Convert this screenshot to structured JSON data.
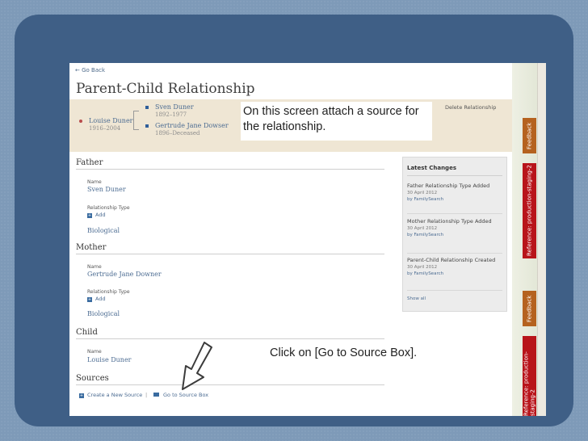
{
  "nav": {
    "go_back": "← Go Back"
  },
  "page": {
    "title": "Parent-Child Relationship",
    "delete_label": "Delete Relationship"
  },
  "tree": {
    "child_name": "Louise Duner",
    "child_years": "1916–2004",
    "father_name": "Sven Duner",
    "father_years": "1892–1977",
    "mother_name": "Gertrude Jane Dowser",
    "mother_years": "1896–Deceased"
  },
  "father": {
    "heading": "Father",
    "name_label": "Name",
    "name": "Sven Duner",
    "rel_type_label": "Relationship Type",
    "add_label": "Add",
    "type_value": "Biological"
  },
  "mother": {
    "heading": "Mother",
    "name_label": "Name",
    "name": "Gertrude Jane Downer",
    "rel_type_label": "Relationship Type",
    "add_label": "Add",
    "type_value": "Biological"
  },
  "child": {
    "heading": "Child",
    "name_label": "Name",
    "name": "Louise Duner"
  },
  "sources": {
    "heading": "Sources",
    "create_label": "Create a New Source",
    "separator": "|",
    "goto_label": "Go to Source Box"
  },
  "latest_changes": {
    "heading": "Latest Changes",
    "items": [
      {
        "title": "Father Relationship Type Added",
        "date": "30 April 2012",
        "by": "by FamilySearch"
      },
      {
        "title": "Mother Relationship Type Added",
        "date": "30 April 2012",
        "by": "by FamilySearch"
      },
      {
        "title": "Parent-Child Relationship Created",
        "date": "30 April 2012",
        "by": "by FamilySearch"
      }
    ],
    "show_all": "Show all"
  },
  "side_tabs": {
    "feedback": "Feedback",
    "reference": "Reference: production-staging-2"
  },
  "callouts": {
    "top": "On this screen attach a source for the relationship.",
    "bottom": "Click on [Go to Source Box]."
  },
  "colors": {
    "slide_frame": "#3f5f86",
    "banner": "#efe6d4",
    "link": "#4c6c92",
    "feedback_tab": "#b5621f",
    "reference_tab": "#b8141a"
  }
}
